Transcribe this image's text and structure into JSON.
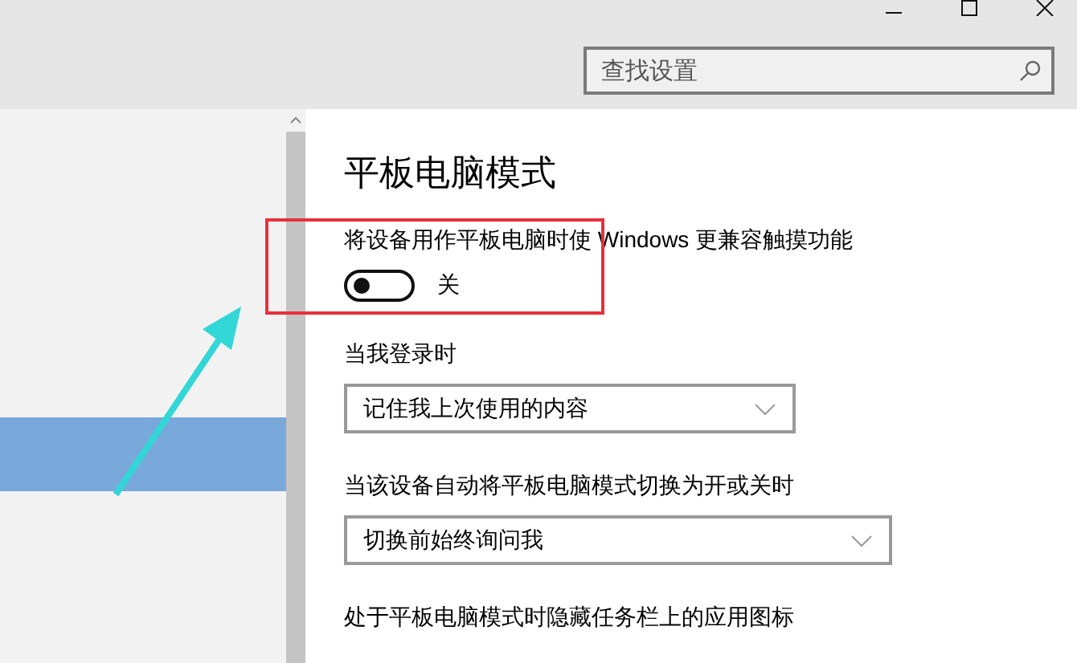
{
  "search": {
    "placeholder": "查找设置"
  },
  "sidebar": {
    "items": [
      {
        "selected": true
      }
    ]
  },
  "page": {
    "title": "平板电脑模式",
    "settings": [
      {
        "kind": "toggle",
        "label": "将设备用作平板电脑时使 Windows 更兼容触摸功能",
        "on": false,
        "state_text": "关"
      },
      {
        "kind": "dropdown",
        "label": "当我登录时",
        "value": "记住我上次使用的内容"
      },
      {
        "kind": "dropdown",
        "label": "当该设备自动将平板电脑模式切换为开或关时",
        "value": "切换前始终询问我"
      },
      {
        "kind": "heading",
        "label": "处于平板电脑模式时隐藏任务栏上的应用图标"
      }
    ]
  }
}
